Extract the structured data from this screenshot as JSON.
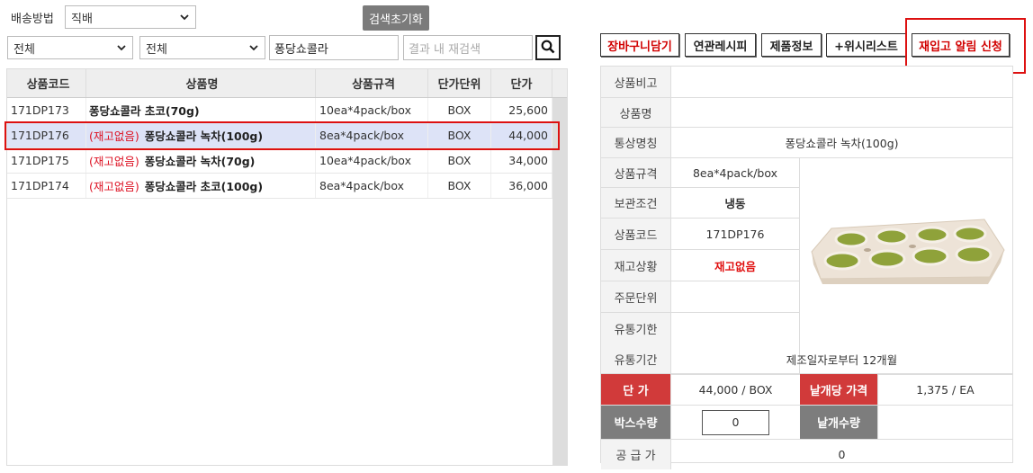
{
  "filters": {
    "delivery_label": "배송방법",
    "delivery_value": "직배",
    "reset_label": "검색초기화",
    "category1_value": "전체",
    "category2_value": "전체",
    "search_value": "퐁당쇼콜라",
    "refine_placeholder": "결과 내 재검색"
  },
  "product_table": {
    "headers": [
      "상품코드",
      "상품명",
      "상품규격",
      "단가단위",
      "단가"
    ],
    "rows": [
      {
        "code": "171DP173",
        "stock": "",
        "name": "퐁당쇼콜라 초코(70g)",
        "spec": "10ea*4pack/box",
        "unit": "BOX",
        "price": "25,600"
      },
      {
        "code": "171DP176",
        "stock": "(재고없음)",
        "name": "퐁당쇼콜라 녹차(100g)",
        "spec": "8ea*4pack/box",
        "unit": "BOX",
        "price": "44,000"
      },
      {
        "code": "171DP175",
        "stock": "(재고없음)",
        "name": "퐁당쇼콜라 녹차(70g)",
        "spec": "10ea*4pack/box",
        "unit": "BOX",
        "price": "34,000"
      },
      {
        "code": "171DP174",
        "stock": "(재고없음)",
        "name": "퐁당쇼콜라 초코(100g)",
        "spec": "8ea*4pack/box",
        "unit": "BOX",
        "price": "36,000"
      }
    ]
  },
  "actions": {
    "cart": "장바구니담기",
    "recipe": "연관레시피",
    "info": "제품정보",
    "wishlist": "+위시리스트",
    "restock": "재입고 알림 신청"
  },
  "detail": {
    "memo_label": "상품비고",
    "memo_value": "",
    "name_label": "상품명",
    "name_value": "",
    "common_label": "통상명칭",
    "common_value": "퐁당쇼콜라 녹차(100g)",
    "spec_label": "상품규격",
    "spec_value": "8ea*4pack/box",
    "storage_label": "보관조건",
    "storage_value": "냉동",
    "code_label": "상품코드",
    "code_value": "171DP176",
    "stock_label": "재고상황",
    "stock_value": "재고없음",
    "order_label": "주문단위",
    "order_value": "",
    "expiry_label": "유통기한",
    "expiry_value": "",
    "period_label": "유통기간",
    "period_value": "제조일자로부터 12개월",
    "price_label": "단 가",
    "price_value": "44,000 / BOX",
    "unit_price_label": "낱개당 가격",
    "unit_price_value": "1,375 / EA",
    "box_qty_label": "박스수량",
    "box_qty_value": "0",
    "piece_qty_label": "낱개수량",
    "supply_label": "공 급 가",
    "supply_value": "0"
  },
  "colors": {
    "highlight_red": "#e01010",
    "selected_row": "#dde3f7",
    "label_red_bg": "#d13a3a",
    "label_gray_bg": "#7d7d7d"
  }
}
